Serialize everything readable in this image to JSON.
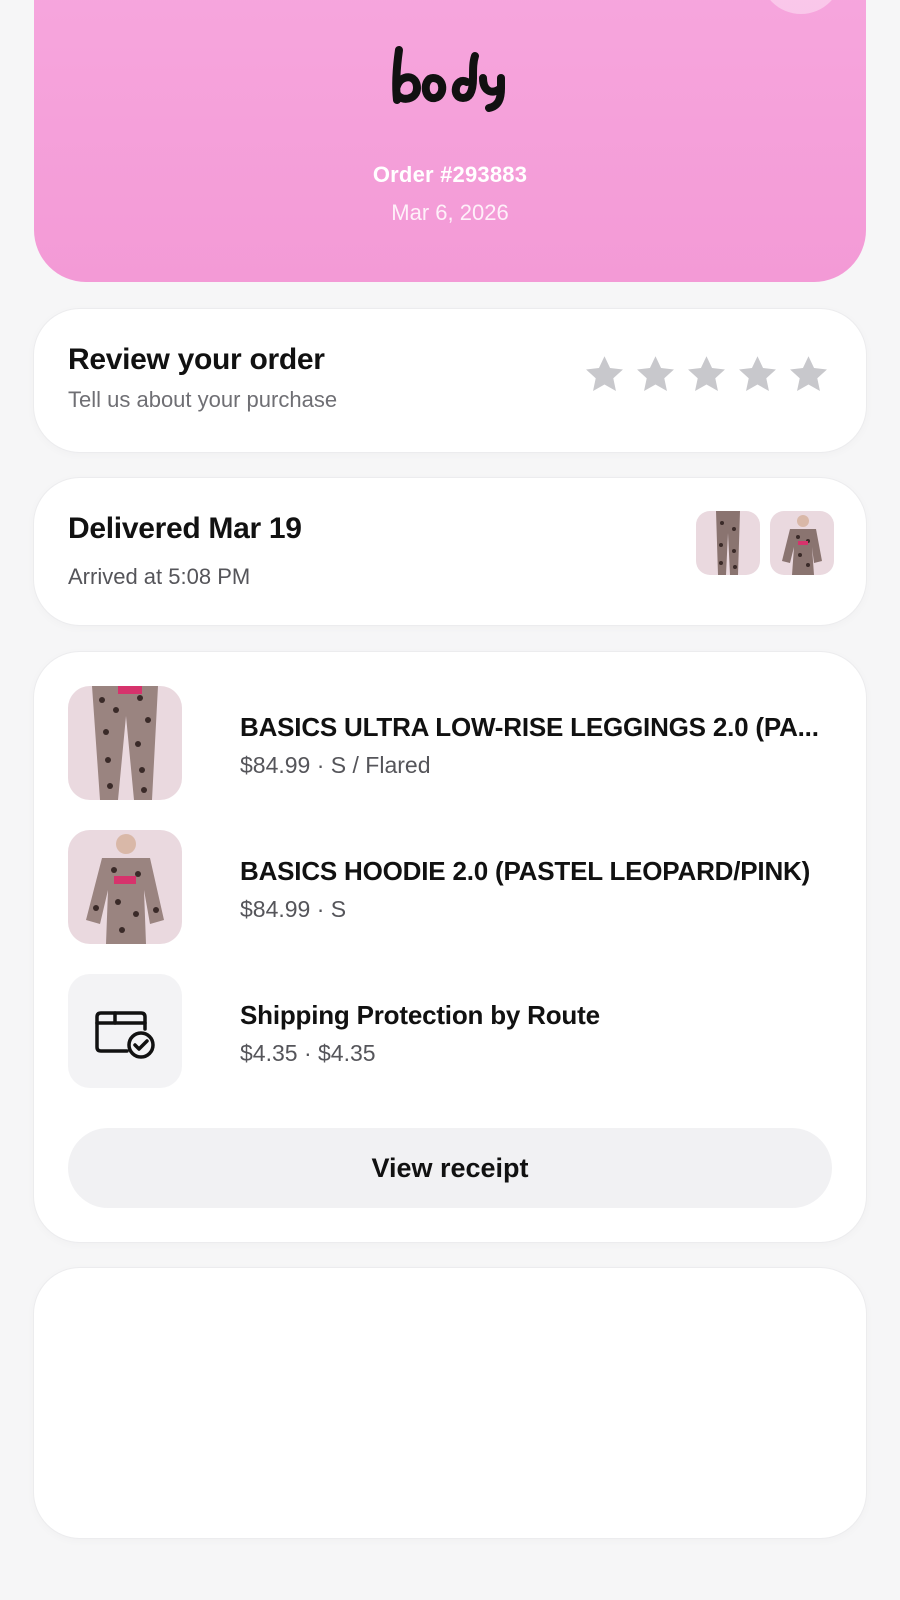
{
  "header": {
    "brand": "body",
    "order_number": "Order #293883",
    "order_date": "Mar 6, 2026",
    "more_icon": "more-horizontal-icon",
    "colors": {
      "gradient_top": "#f7a7de",
      "gradient_bottom": "#f39ad6"
    }
  },
  "review": {
    "title": "Review your order",
    "subtitle": "Tell us about your purchase",
    "rating": 0,
    "max_rating": 5
  },
  "delivery": {
    "title": "Delivered Mar 19",
    "subtitle": "Arrived at 5:08 PM"
  },
  "items": [
    {
      "name": "BASICS ULTRA LOW-RISE LEGGINGS 2.0 (PA...",
      "meta": "$84.99 · S / Flared"
    },
    {
      "name": "BASICS HOODIE 2.0 (PASTEL LEOPARD/PINK)",
      "meta": "$84.99 · S"
    },
    {
      "name": "Shipping Protection by Route",
      "meta": "$4.35 · $4.35",
      "icon": "package-check-icon"
    }
  ],
  "actions": {
    "view_receipt": "View receipt"
  }
}
